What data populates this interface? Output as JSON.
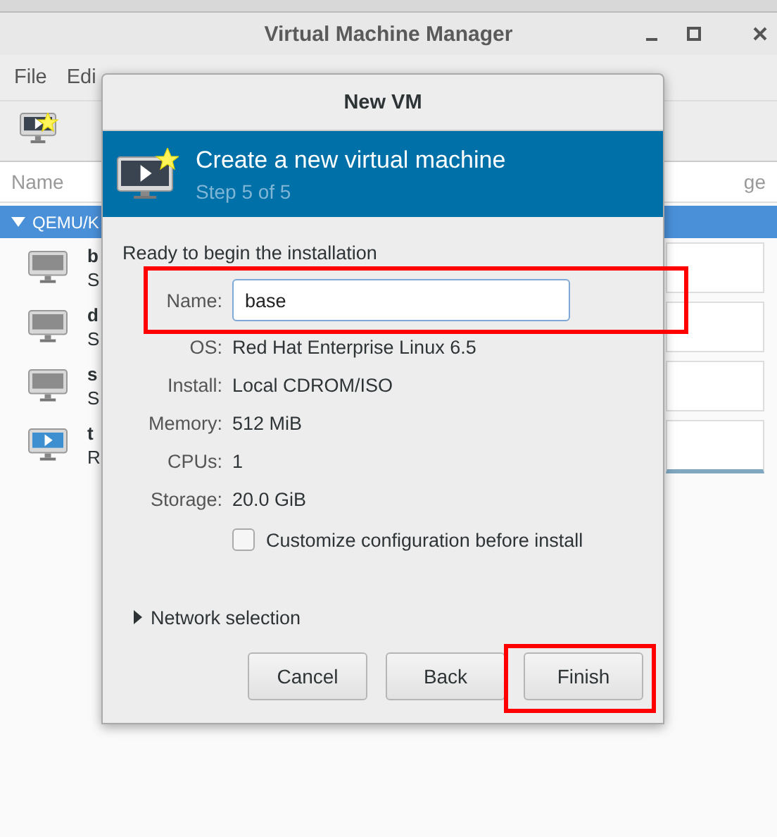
{
  "window": {
    "title": "Virtual Machine Manager"
  },
  "menu": [
    "File",
    "Edi"
  ],
  "vm_list": {
    "column_1": "Name",
    "column_2": "ge",
    "group": {
      "label": "QEMU/K",
      "expanded": true,
      "selected": true
    },
    "rows": [
      {
        "name": "b",
        "status": "S",
        "running": false
      },
      {
        "name": "d",
        "status": "S",
        "running": false
      },
      {
        "name": "s",
        "status": "S",
        "running": false
      },
      {
        "name": "t",
        "status": "R",
        "running": true
      }
    ]
  },
  "dialog": {
    "title": "New VM",
    "header": {
      "title": "Create a new virtual machine",
      "step": "Step 5 of 5"
    },
    "intro": "Ready to begin the installation",
    "fields": [
      {
        "kind": "input",
        "label": "Name:",
        "value": "base",
        "highlighted": true
      },
      {
        "kind": "text",
        "label": "OS:",
        "value": "Red Hat Enterprise Linux 6.5"
      },
      {
        "kind": "text",
        "label": "Install:",
        "value": "Local CDROM/ISO"
      },
      {
        "kind": "text",
        "label": "Memory:",
        "value": "512 MiB"
      },
      {
        "kind": "text",
        "label": "CPUs:",
        "value": "1"
      },
      {
        "kind": "text",
        "label": "Storage:",
        "value": "20.0 GiB"
      }
    ],
    "checkbox": {
      "label": "Customize configuration before install",
      "checked": false
    },
    "expander": {
      "label": "Network selection",
      "expanded": false
    },
    "buttons": [
      {
        "label": "Cancel",
        "highlighted": false
      },
      {
        "label": "Back",
        "highlighted": false
      },
      {
        "label": "Finish",
        "highlighted": true
      }
    ]
  }
}
